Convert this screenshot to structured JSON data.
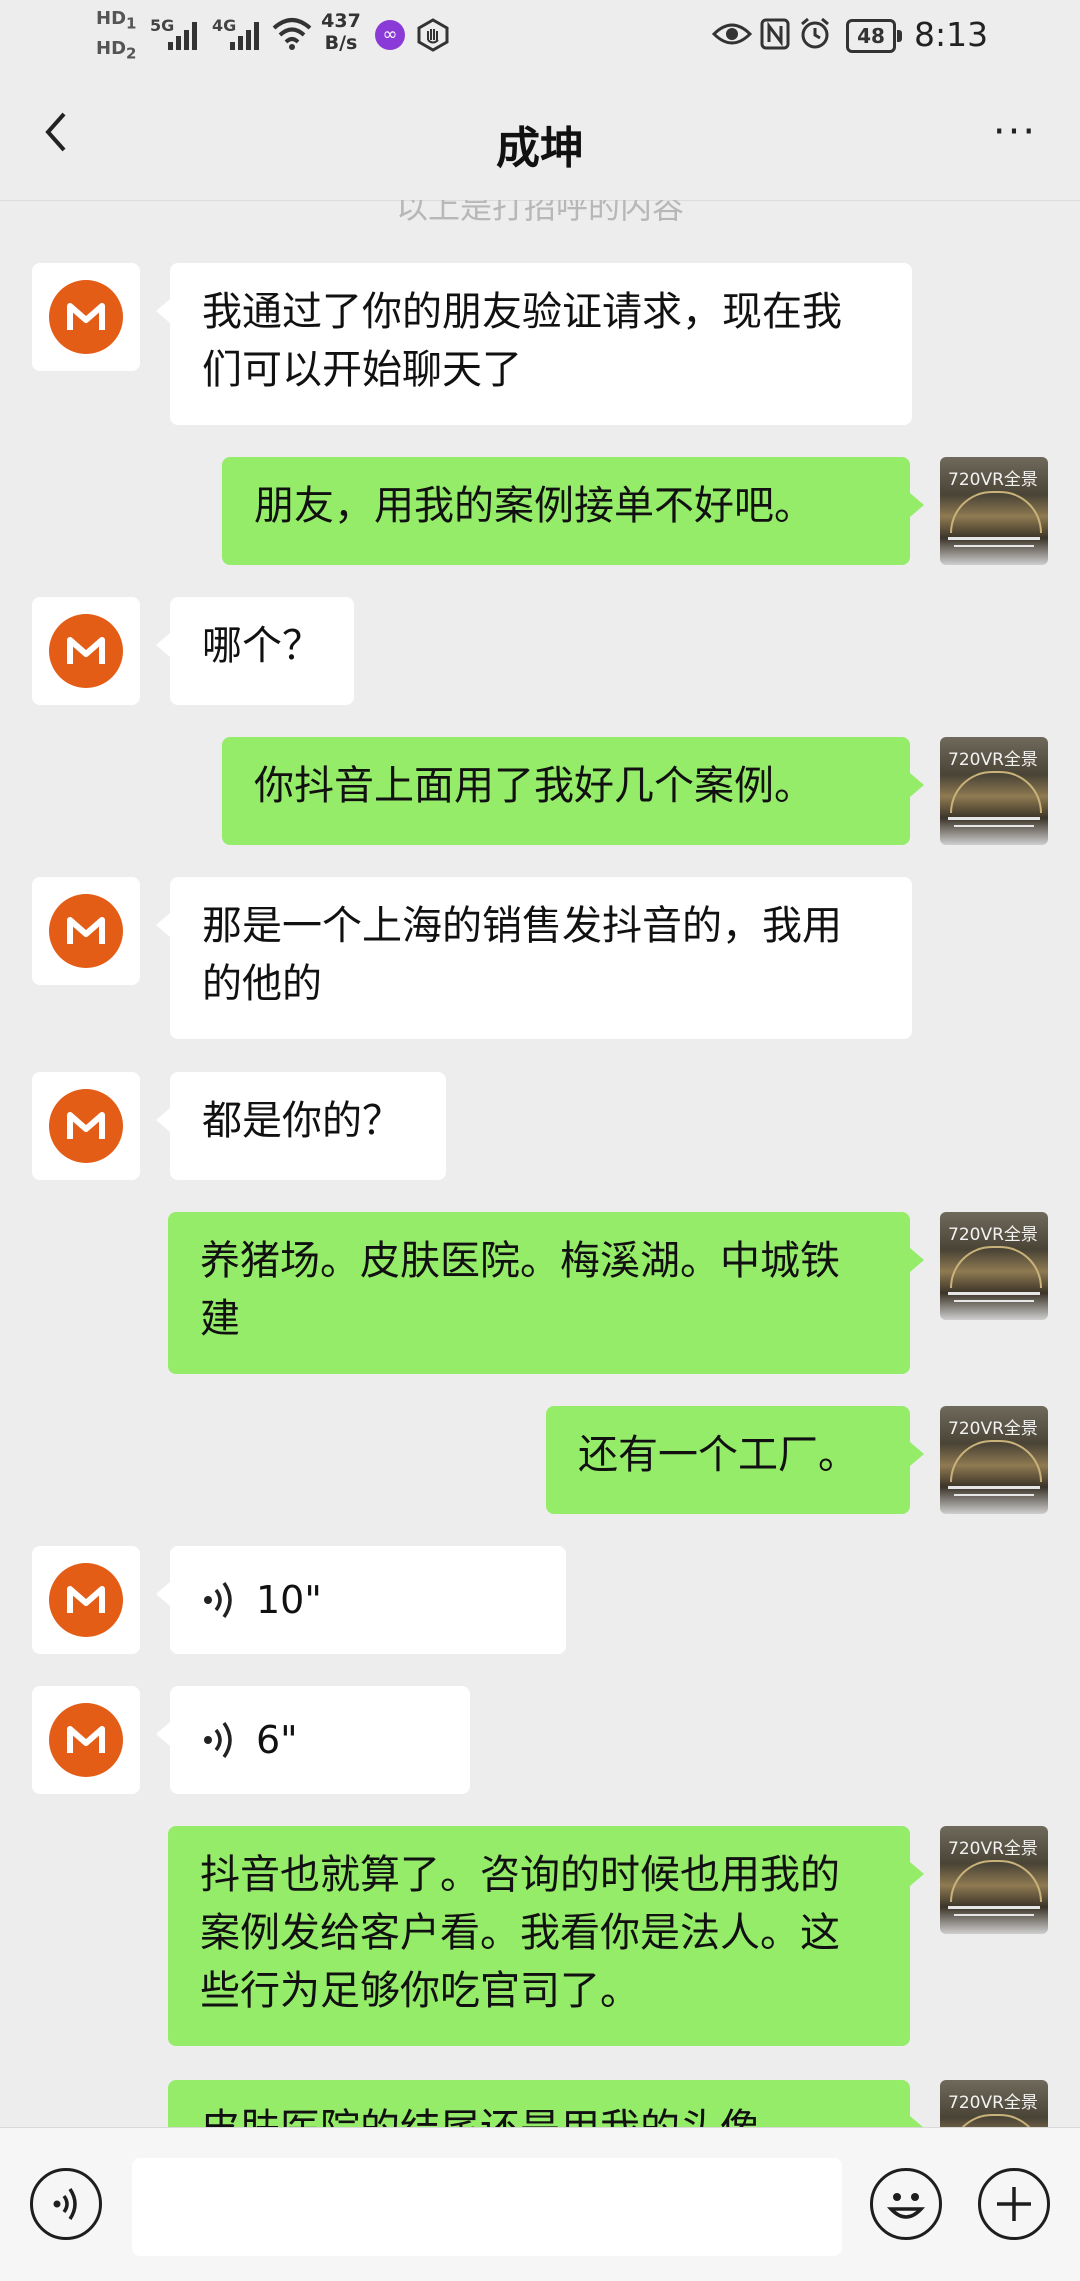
{
  "status_bar": {
    "hd1": "HD",
    "hd1_sub": "1",
    "hd2": "HD",
    "hd2_sub": "2",
    "sig1": "5G",
    "sig2": "4G",
    "speed_value": "437",
    "speed_unit": "B/s",
    "battery": "48",
    "time": "8:13"
  },
  "header": {
    "title": "成坤",
    "more": "···"
  },
  "chat": {
    "note": "以上是打招呼的内容",
    "messages": [
      {
        "side": "left",
        "text": "我通过了你的朋友验证请求，现在我们可以开始聊天了"
      },
      {
        "side": "right",
        "text": "朋友，用我的案例接单不好吧。"
      },
      {
        "side": "left",
        "text": "哪个？"
      },
      {
        "side": "right",
        "text": "你抖音上面用了我好几个案例。"
      },
      {
        "side": "left",
        "text": "那是一个上海的销售发抖音的，我用的他的"
      },
      {
        "side": "left",
        "text": "都是你的？"
      },
      {
        "side": "right",
        "text": "养猪场。皮肤医院。梅溪湖。中城铁建"
      },
      {
        "side": "right",
        "text": "还有一个工厂。"
      },
      {
        "side": "left",
        "voice": "10\""
      },
      {
        "side": "left",
        "voice": "6\""
      },
      {
        "side": "right",
        "text": "抖音也就算了。咨询的时候也用我的案例发给客户看。我看你是法人。这些行为足够你吃官司了。"
      },
      {
        "side": "right",
        "text": "皮肤医院的结尾还是用我的头像"
      }
    ],
    "thumb_label": "720VR全景"
  }
}
